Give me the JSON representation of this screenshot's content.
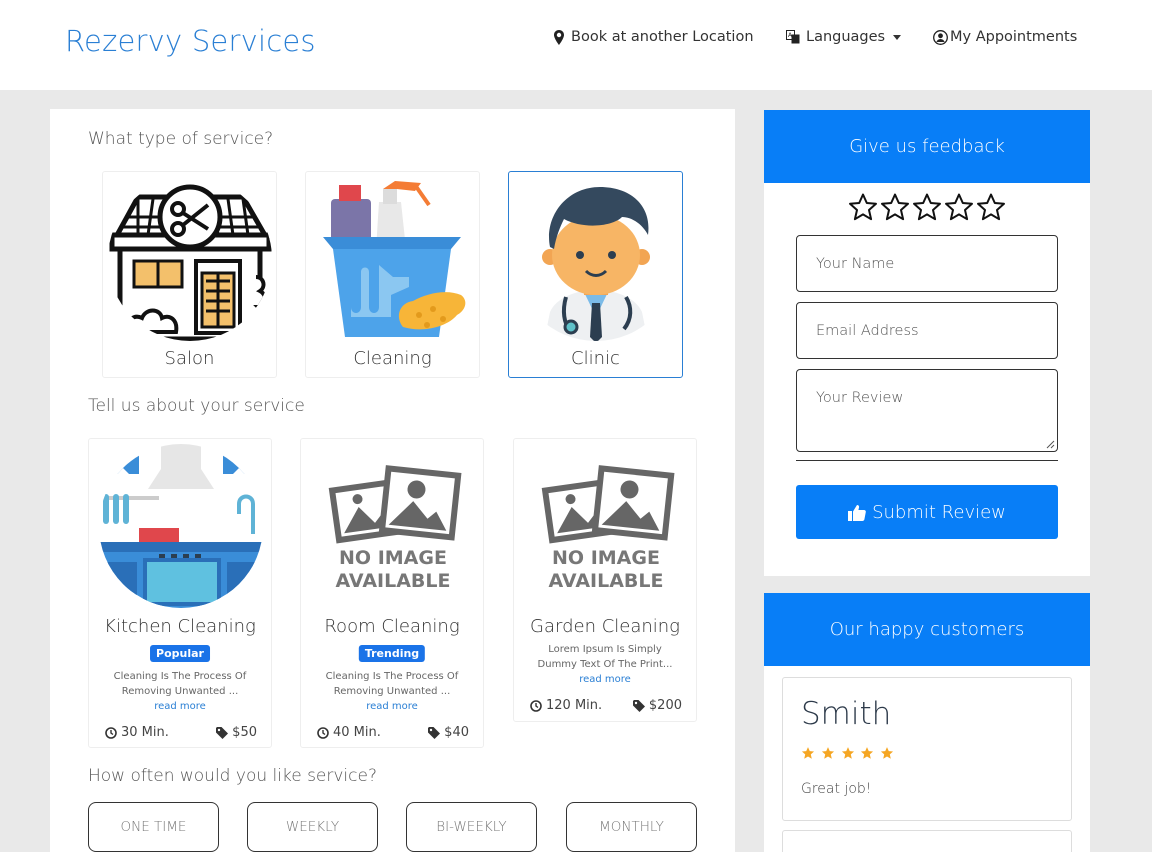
{
  "header": {
    "brand": "Rezervy Services",
    "nav": {
      "book_location": "Book at another Location",
      "languages": "Languages",
      "appointments": "My Appointments"
    }
  },
  "service_types": {
    "heading": "What type of service?",
    "items": [
      {
        "label": "Salon",
        "icon": "salon-icon",
        "selected": false
      },
      {
        "label": "Cleaning",
        "icon": "cleaning-icon",
        "selected": false
      },
      {
        "label": "Clinic",
        "icon": "doctor-icon",
        "selected": true
      }
    ]
  },
  "services": {
    "heading": "Tell us about your service",
    "items": [
      {
        "name": "Kitchen Cleaning",
        "badge": "Popular",
        "description": "Cleaning Is The Process Of Removing Unwanted ...",
        "read_more": "read more",
        "duration": "30 Min.",
        "price": "$50",
        "image": "kitchen-image"
      },
      {
        "name": "Room Cleaning",
        "badge": "Trending",
        "description": "Cleaning Is The Process Of Removing Unwanted ...",
        "read_more": "read more",
        "duration": "40 Min.",
        "price": "$40",
        "image": "no-image-placeholder",
        "placeholder_line1": "NO IMAGE",
        "placeholder_line2": "AVAILABLE"
      },
      {
        "name": "Garden Cleaning",
        "badge": "",
        "description": "Lorem Ipsum Is Simply Dummy Text Of The Print...",
        "read_more": "read more",
        "duration": "120 Min.",
        "price": "$200",
        "image": "no-image-placeholder",
        "placeholder_line1": "NO IMAGE",
        "placeholder_line2": "AVAILABLE"
      }
    ]
  },
  "frequency": {
    "heading": "How often would you like service?",
    "options": [
      "ONE TIME",
      "WEEKLY",
      "BI-WEEKLY",
      "MONTHLY"
    ]
  },
  "feedback": {
    "title": "Give us feedback",
    "rating": 0,
    "max_rating": 5,
    "name_placeholder": "Your Name",
    "email_placeholder": "Email Address",
    "review_placeholder": "Your Review",
    "submit_label": "Submit Review"
  },
  "customers": {
    "title": "Our happy customers",
    "testimonials": [
      {
        "name": "Smith",
        "stars": 5,
        "text": "Great job!"
      }
    ]
  },
  "colors": {
    "brand": "#2a7fd4",
    "primary": "#087ef7",
    "badge": "#1a73e8",
    "star_gold": "#f5a623"
  }
}
